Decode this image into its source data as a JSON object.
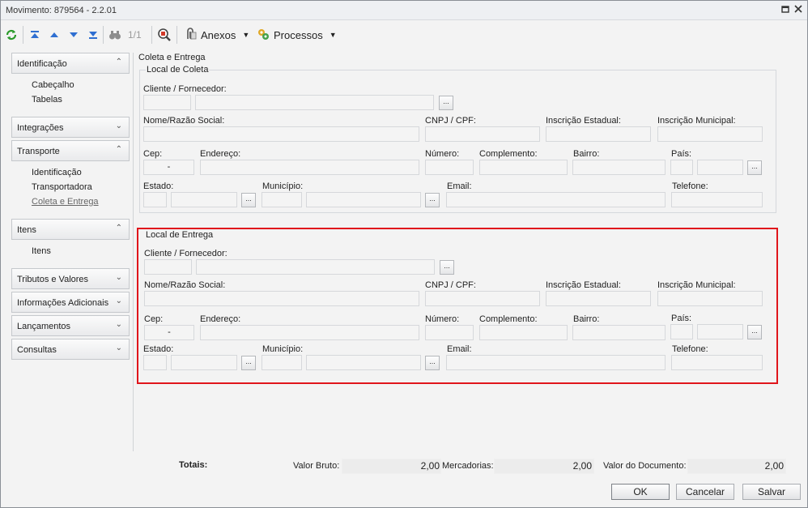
{
  "window": {
    "title": "Movimento: 879564 - 2.2.01"
  },
  "toolbar": {
    "page_counter": "1/1",
    "anexos_label": "Anexos",
    "processos_label": "Processos"
  },
  "sidebar": {
    "groups": [
      {
        "label": "Identificação",
        "items": [
          "Cabeçalho",
          "Tabelas"
        ]
      },
      {
        "label": "Integrações"
      },
      {
        "label": "Transporte",
        "items": [
          "Identificação",
          "Transportadora",
          "Coleta e Entrega"
        ]
      },
      {
        "label": "Itens",
        "items": [
          "Itens"
        ]
      },
      {
        "label": "Tributos e Valores"
      },
      {
        "label": "Informações Adicionais"
      },
      {
        "label": "Lançamentos"
      },
      {
        "label": "Consultas"
      }
    ]
  },
  "page": {
    "title": "Coleta e Entrega"
  },
  "coleta": {
    "title": "Local de Coleta",
    "cliente_label": "Cliente / Fornecedor:",
    "nome_label": "Nome/Razão Social:",
    "cnpj_label": "CNPJ / CPF:",
    "ie_label": "Inscrição Estadual:",
    "im_label": "Inscrição Municipal:",
    "cep_label": "Cep:",
    "cep_value": "-",
    "endereco_label": "Endereço:",
    "numero_label": "Número:",
    "complemento_label": "Complemento:",
    "bairro_label": "Bairro:",
    "pais_label": "País:",
    "estado_label": "Estado:",
    "municipio_label": "Município:",
    "email_label": "Email:",
    "telefone_label": "Telefone:"
  },
  "entrega": {
    "title": "Local de Entrega",
    "cliente_label": "Cliente / Fornecedor:",
    "nome_label": "Nome/Razão Social:",
    "cnpj_label": "CNPJ / CPF:",
    "ie_label": "Inscrição Estadual:",
    "im_label": "Inscrição Municipal:",
    "cep_label": "Cep:",
    "cep_value": "-",
    "endereco_label": "Endereço:",
    "numero_label": "Número:",
    "complemento_label": "Complemento:",
    "bairro_label": "Bairro:",
    "pais_label": "País:",
    "estado_label": "Estado:",
    "municipio_label": "Município:",
    "email_label": "Email:",
    "telefone_label": "Telefone:"
  },
  "ellipsis": "...",
  "totals": {
    "label": "Totais:",
    "valor_bruto_label": "Valor Bruto:",
    "valor_bruto": "2,00",
    "mercadorias_label": "Mercadorias:",
    "mercadorias": "2,00",
    "valor_documento_label": "Valor do Documento:",
    "valor_documento": "2,00"
  },
  "footer": {
    "ok": "OK",
    "cancelar": "Cancelar",
    "salvar": "Salvar"
  },
  "icons": [
    "refresh-icon",
    "first-record-icon",
    "previous-record-icon",
    "next-record-icon",
    "last-record-icon",
    "binoculars-icon",
    "zoom-search-icon",
    "paperclip-icon",
    "process-gear-icon",
    "restore-icon",
    "close-icon"
  ],
  "colors": {
    "highlight": "#e0151b",
    "refresh": "#2a9a2a",
    "nav_arrows": "#2f6fd1"
  }
}
